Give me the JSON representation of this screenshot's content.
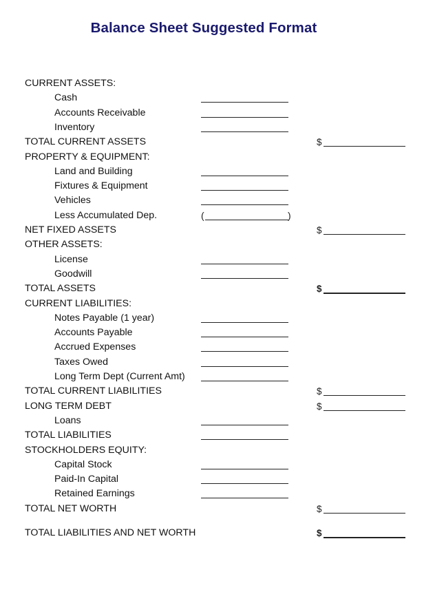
{
  "title": "Balance Sheet Suggested Format",
  "currency_symbol": "$",
  "rows": [
    {
      "label": "CURRENT ASSETS:",
      "kind": "section",
      "field": "none"
    },
    {
      "label": "Cash",
      "kind": "item",
      "field": "sub"
    },
    {
      "label": "Accounts Receivable",
      "kind": "item",
      "field": "sub"
    },
    {
      "label": "Inventory",
      "kind": "item",
      "field": "sub"
    },
    {
      "label": "TOTAL CURRENT ASSETS",
      "kind": "section",
      "field": "total"
    },
    {
      "label": "PROPERTY & EQUIPMENT:",
      "kind": "section",
      "field": "none"
    },
    {
      "label": "Land and Building",
      "kind": "item",
      "field": "sub"
    },
    {
      "label": "Fixtures & Equipment",
      "kind": "item",
      "field": "sub"
    },
    {
      "label": "Vehicles",
      "kind": "item",
      "field": "sub"
    },
    {
      "label": "Less Accumulated Dep.",
      "kind": "item",
      "field": "paren"
    },
    {
      "label": "NET FIXED ASSETS",
      "kind": "section",
      "field": "total"
    },
    {
      "label": "OTHER ASSETS:",
      "kind": "section",
      "field": "none"
    },
    {
      "label": "License",
      "kind": "item",
      "field": "sub"
    },
    {
      "label": "Goodwill",
      "kind": "item",
      "field": "sub"
    },
    {
      "label": "TOTAL ASSETS",
      "kind": "section",
      "field": "total-bold"
    },
    {
      "label": "CURRENT LIABILITIES:",
      "kind": "section",
      "field": "none"
    },
    {
      "label": "Notes Payable (1 year)",
      "kind": "item",
      "field": "sub"
    },
    {
      "label": "Accounts Payable",
      "kind": "item",
      "field": "sub"
    },
    {
      "label": "Accrued Expenses",
      "kind": "item",
      "field": "sub"
    },
    {
      "label": "Taxes Owed",
      "kind": "item",
      "field": "sub"
    },
    {
      "label": "Long Term Dept (Current Amt)",
      "kind": "item",
      "field": "sub"
    },
    {
      "label": "TOTAL CURRENT LIABILITIES",
      "kind": "section",
      "field": "total"
    },
    {
      "label": "LONG TERM DEBT",
      "kind": "section",
      "field": "total"
    },
    {
      "label": "Loans",
      "kind": "item",
      "field": "sub"
    },
    {
      "label": "TOTAL LIABILITIES",
      "kind": "section",
      "field": "sub"
    },
    {
      "label": "STOCKHOLDERS EQUITY:",
      "kind": "section",
      "field": "none"
    },
    {
      "label": "Capital Stock",
      "kind": "item",
      "field": "sub"
    },
    {
      "label": "Paid-In Capital",
      "kind": "item",
      "field": "sub"
    },
    {
      "label": "Retained Earnings",
      "kind": "item",
      "field": "sub"
    },
    {
      "label": "TOTAL NET WORTH",
      "kind": "section",
      "field": "total"
    },
    {
      "label": "TOTAL LIABILITIES AND NET WORTH",
      "kind": "section",
      "field": "total-bold",
      "gap_before": true
    }
  ]
}
